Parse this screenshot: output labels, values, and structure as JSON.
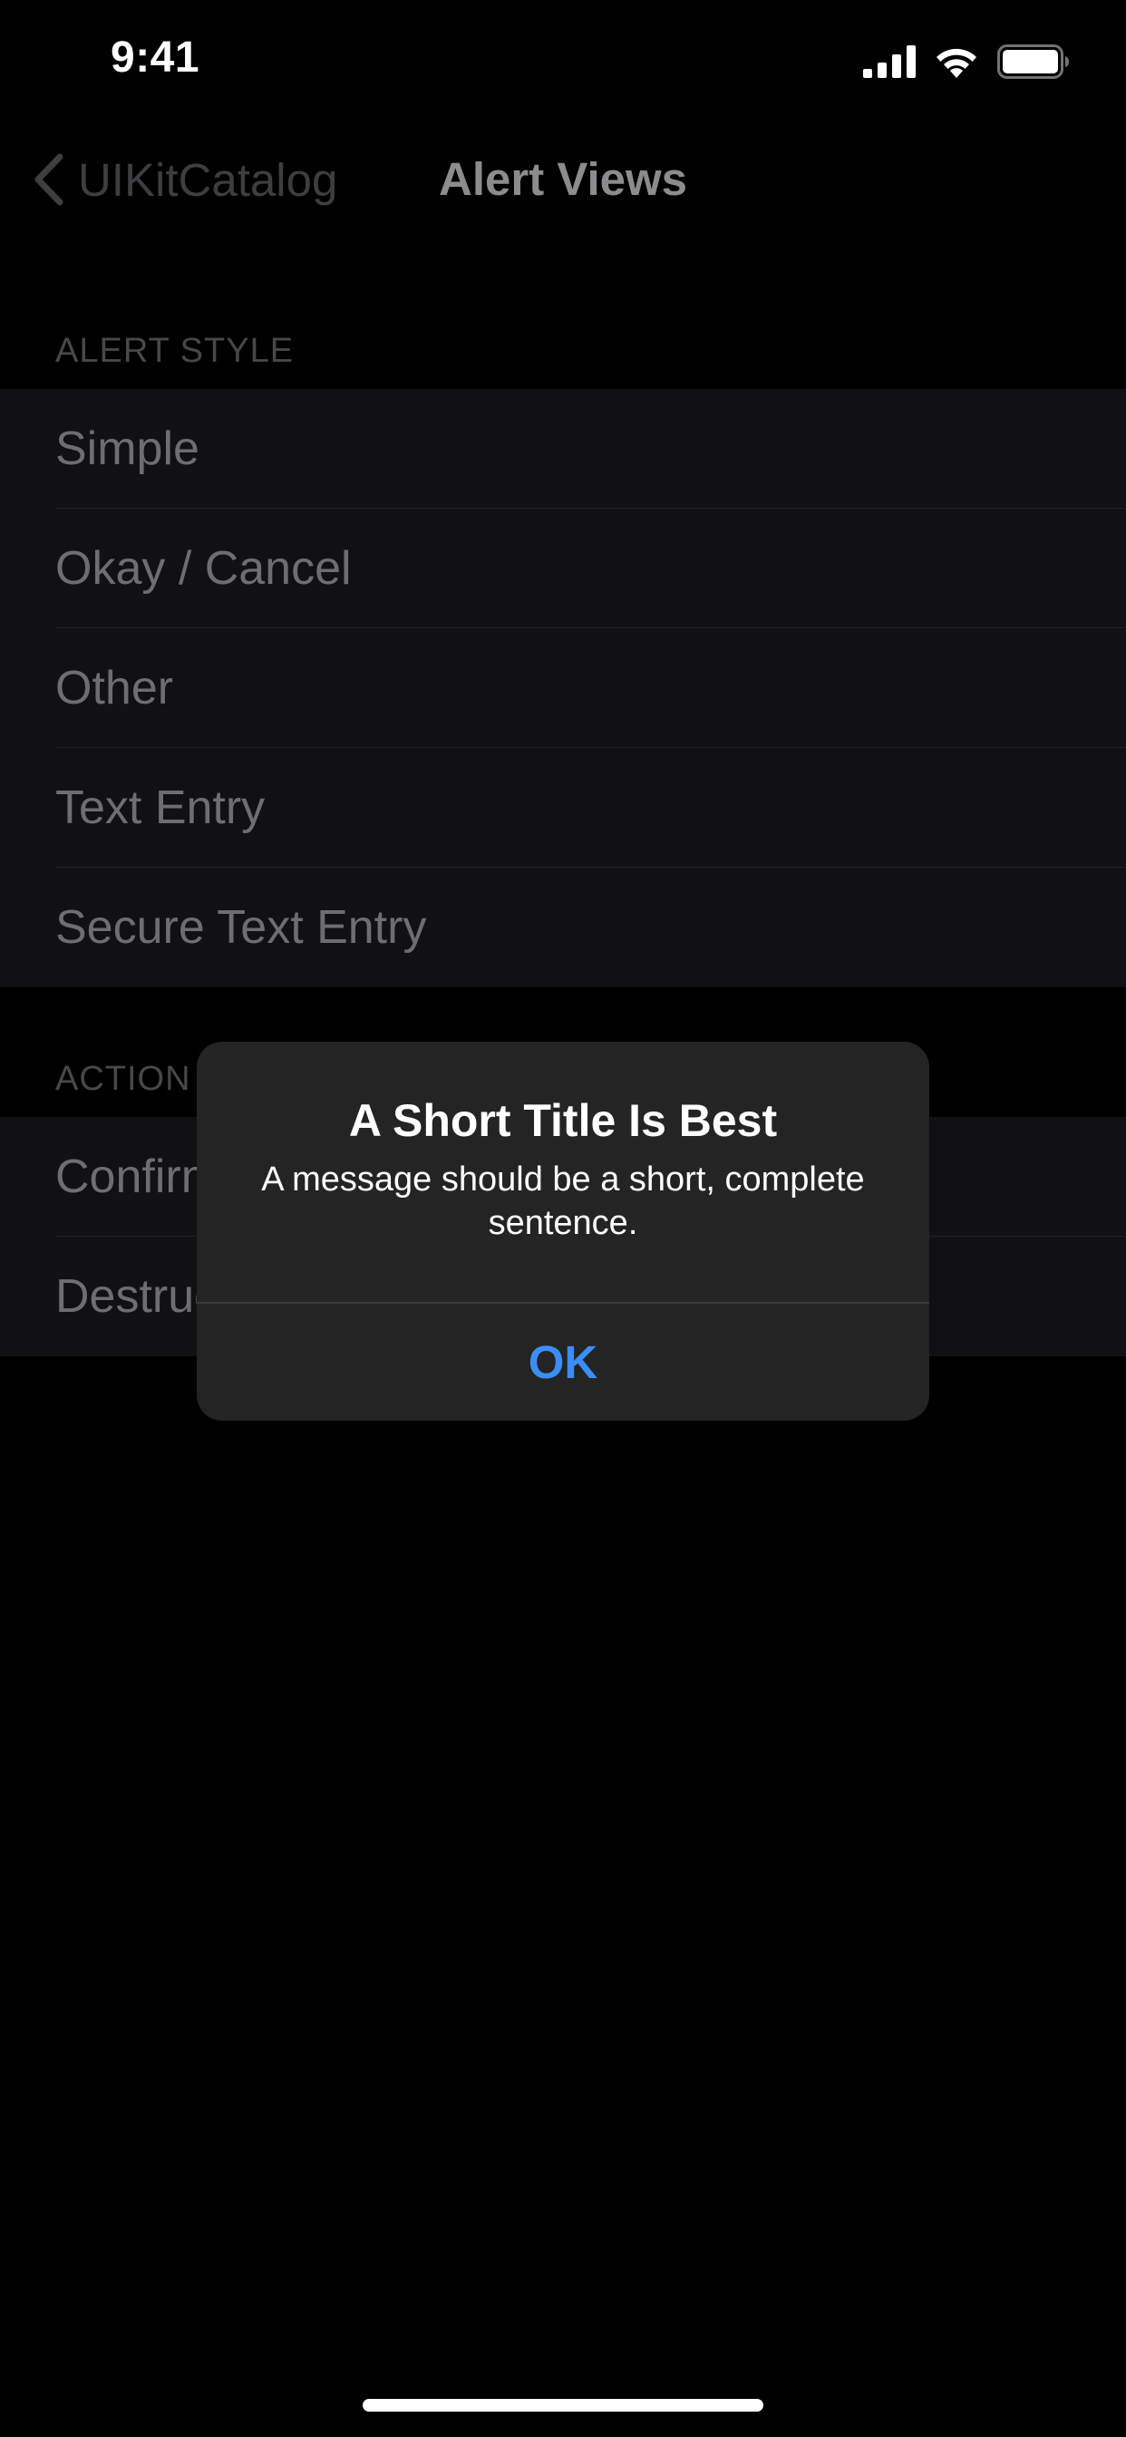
{
  "status_bar": {
    "time": "9:41"
  },
  "nav": {
    "back_label": "UIKitCatalog",
    "title": "Alert Views"
  },
  "sections": [
    {
      "header": "ALERT STYLE",
      "rows": [
        "Simple",
        "Okay / Cancel",
        "Other",
        "Text Entry",
        "Secure Text Entry"
      ]
    },
    {
      "header": "ACTION",
      "rows": [
        "Confirm",
        "Destructive"
      ]
    }
  ],
  "alert": {
    "title": "A Short Title Is Best",
    "message": "A message should be a short, complete sentence.",
    "ok_label": "OK"
  },
  "colors": {
    "accent": "#3b8ef6",
    "background": "#000000",
    "cell_background": "#111113"
  },
  "icons": [
    "cellular-signal-icon",
    "wifi-icon",
    "battery-icon",
    "chevron-left-icon"
  ]
}
